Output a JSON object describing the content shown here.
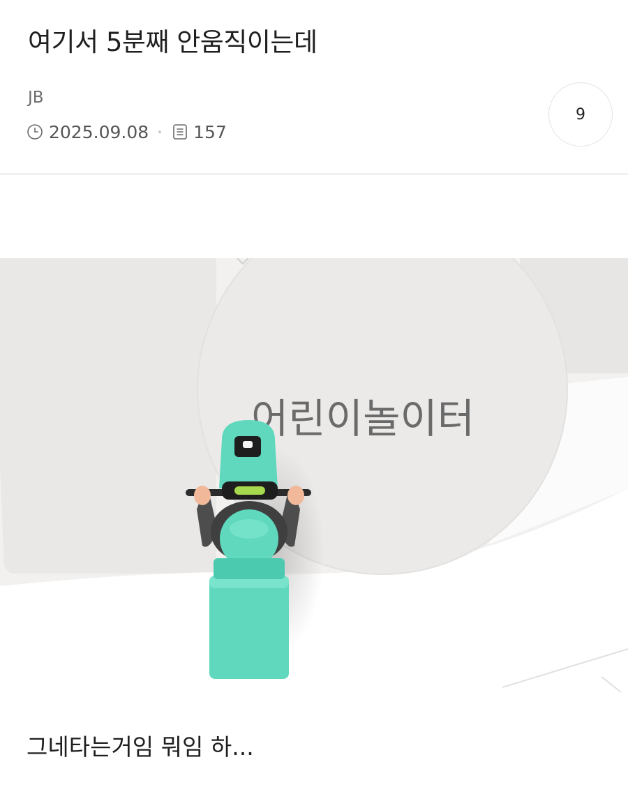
{
  "post": {
    "title": "여기서 5분째 안움직이는데",
    "author": "JB",
    "date": "2025.09.08",
    "views": "157",
    "comment_count": "9",
    "body_text": "그네타는거임 뭐임 하..."
  },
  "map": {
    "place_label": "어린이놀이터",
    "rider_color": "#5fd8bd"
  },
  "icons": {
    "date": "clock-icon",
    "views": "document-icon"
  }
}
